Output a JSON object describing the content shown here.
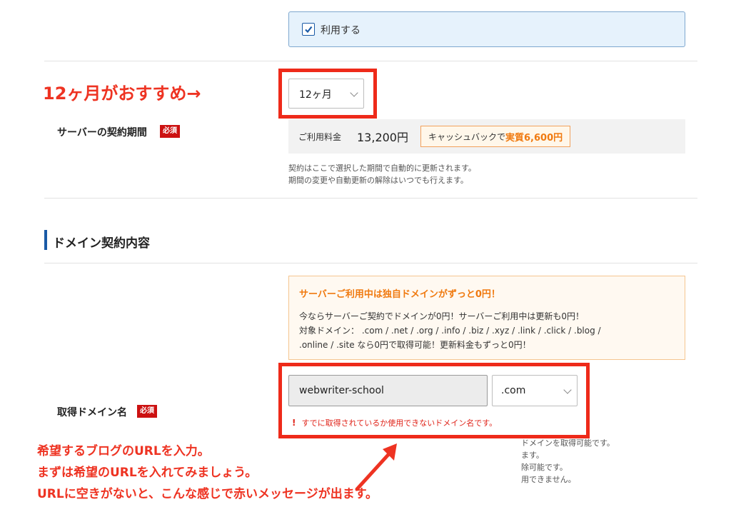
{
  "use_option": {
    "label": "利用する",
    "checked": true
  },
  "period_annotation": "12ヶ月がおすすめ→",
  "period_select": {
    "value": "12ヶ月"
  },
  "server_period": {
    "label": "サーバーの契約期間",
    "required_badge": "必須"
  },
  "fee": {
    "label": "ご利用料金",
    "amount": "13,200円",
    "cashback_prefix": "キャッシュバックで",
    "cashback_value": "実質6,600円"
  },
  "period_notes": [
    "契約はここで選択した期間で自動的に更新されます。",
    "期間の変更や自動更新の解除はいつでも行えます。"
  ],
  "section_title": "ドメイン契約内容",
  "promo": {
    "title": "サーバーご利用中は独自ドメインがずっと0円！",
    "lines": [
      "今ならサーバーご契約でドメインが0円！サーバーご利用中は更新も0円！",
      "対象ドメイン： .com / .net / .org / .info / .biz / .xyz / .link / .click / .blog /",
      ".online / .site なら0円で取得可能！更新料金もずっと0円！"
    ]
  },
  "domain": {
    "label": "取得ドメイン名",
    "required_badge": "必須",
    "input_value": "webwriter-school",
    "tld_value": ".com",
    "error_text": "すでに取得されているか使用できないドメイン名です。"
  },
  "partial_notes": [
    "ドメインを取得可能です。",
    "ます。",
    "除可能です。",
    "用できません。"
  ],
  "bottom_annotation": [
    "希望するブログのURLを入力。",
    "まずは希望のURLを入れてみましょう。",
    "URLに空きがないと、こんな感じで赤いメッセージが出ます。"
  ],
  "colors": {
    "accent_red": "#ee3322",
    "orange": "#f07a10",
    "blue_bar": "#1a5aa6"
  }
}
